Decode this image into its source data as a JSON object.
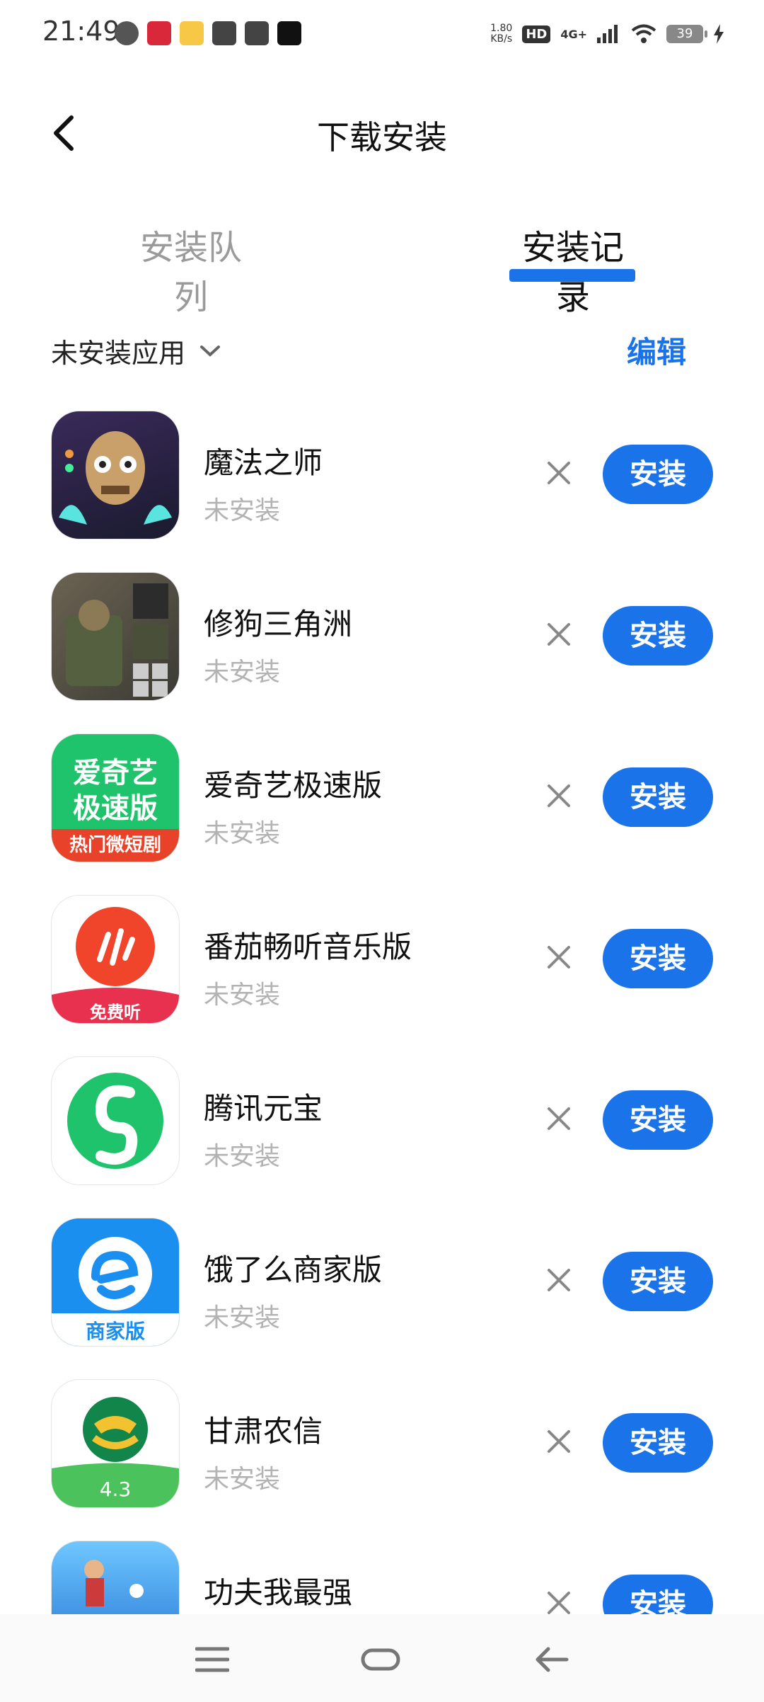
{
  "status_bar": {
    "time": "21:49",
    "speed_value": "1.80",
    "speed_unit": "KB/s",
    "hd": "HD",
    "network": "4G+",
    "battery": "39",
    "notification_icons": [
      "wechat-icon",
      "red-app-icon",
      "yellow-app-icon",
      "card-icon",
      "play-icon",
      "music-icon"
    ]
  },
  "header": {
    "title": "下载安装"
  },
  "tabs": {
    "queue": "安装队列",
    "history": "安装记录"
  },
  "filter": {
    "label": "未安装应用",
    "edit": "编辑"
  },
  "apps": [
    {
      "name": "魔法之师",
      "status": "未安装",
      "action": "安装"
    },
    {
      "name": "修狗三角洲",
      "status": "未安装",
      "action": "安装"
    },
    {
      "name": "爱奇艺极速版",
      "status": "未安装",
      "action": "安装",
      "icon_text_1": "爱奇艺",
      "icon_text_2": "极速版",
      "icon_text_3": "热门微短剧"
    },
    {
      "name": "番茄畅听音乐版",
      "status": "未安装",
      "action": "安装",
      "icon_text_1": "免费听"
    },
    {
      "name": "腾讯元宝",
      "status": "未安装",
      "action": "安装"
    },
    {
      "name": "饿了么商家版",
      "status": "未安装",
      "action": "安装",
      "icon_text_1": "商家版"
    },
    {
      "name": "甘肃农信",
      "status": "未安装",
      "action": "安装",
      "icon_text_1": "4.3"
    },
    {
      "name": "功夫我最强",
      "status": "",
      "action": "安装"
    }
  ],
  "colors": {
    "accent": "#1a73e8",
    "status_gray": "#b3b3b3"
  }
}
